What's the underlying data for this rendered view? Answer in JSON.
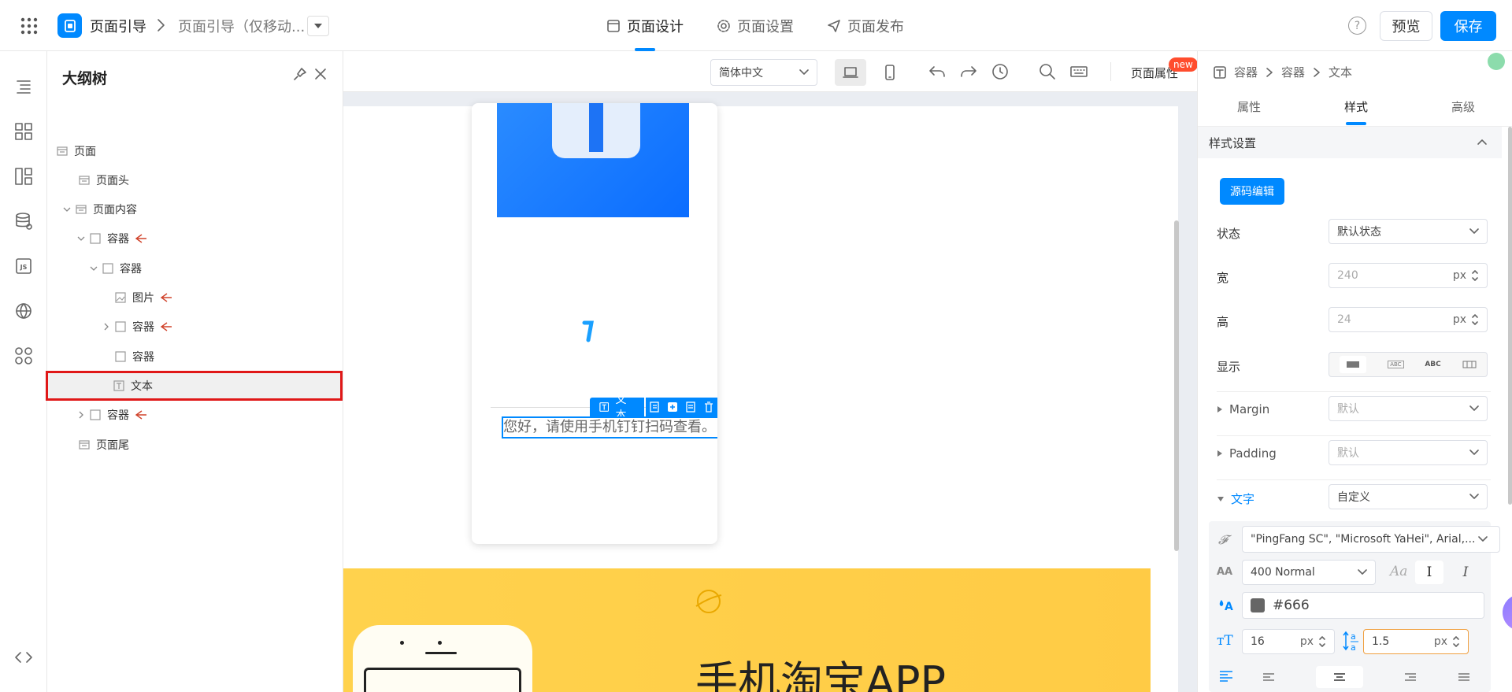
{
  "header": {
    "app_name": "页面引导",
    "breadcrumb_current": "页面引导（仅移动...",
    "tabs": [
      {
        "label": "页面设计",
        "active": true
      },
      {
        "label": "页面设置",
        "active": false
      },
      {
        "label": "页面发布",
        "active": false
      }
    ],
    "preview_label": "预览",
    "save_label": "保存",
    "accent_color": "#0089ff"
  },
  "outline": {
    "title": "大纲树",
    "nodes": [
      {
        "label": "页面"
      },
      {
        "label": "页面头"
      },
      {
        "label": "页面内容"
      },
      {
        "label": "容器"
      },
      {
        "label": "容器"
      },
      {
        "label": "图片"
      },
      {
        "label": "容器"
      },
      {
        "label": "容器"
      },
      {
        "label": "文本",
        "selected": true
      },
      {
        "label": "容器"
      },
      {
        "label": "页面尾"
      }
    ]
  },
  "canvas_toolbar": {
    "language": "简体中文",
    "page_attr_label": "页面属性",
    "new_badge": "new"
  },
  "canvas": {
    "selected_tag": "文本",
    "text_content": "您好，请使用手机钉钉扫码查看。",
    "banner_text": "手机淘宝APP"
  },
  "right_panel": {
    "breadcrumb": [
      "容器",
      "容器",
      "文本"
    ],
    "tabs": [
      {
        "label": "属性",
        "active": false
      },
      {
        "label": "样式",
        "active": true
      },
      {
        "label": "高级",
        "active": false
      }
    ],
    "section_title": "样式设置",
    "source_edit_label": "源码编辑",
    "state": {
      "label": "状态",
      "value": "默认状态"
    },
    "width": {
      "label": "宽",
      "value": "240",
      "unit": "px"
    },
    "height": {
      "label": "高",
      "value": "24",
      "unit": "px"
    },
    "display": {
      "label": "显示",
      "options": [
        "ABC",
        "ABC"
      ]
    },
    "margin": {
      "label": "Margin",
      "value": "默认"
    },
    "padding": {
      "label": "Padding",
      "value": "默认"
    },
    "text": {
      "label": "文字",
      "value": "自定义"
    },
    "font_family": "\"PingFang SC\", \"Microsoft YaHei\", Arial,...",
    "font_weight": "400 Normal",
    "font_italic": "I",
    "font_color": "#666",
    "font_size": {
      "value": "16",
      "unit": "px"
    },
    "line_height": {
      "value": "1.5",
      "unit": "px"
    }
  }
}
